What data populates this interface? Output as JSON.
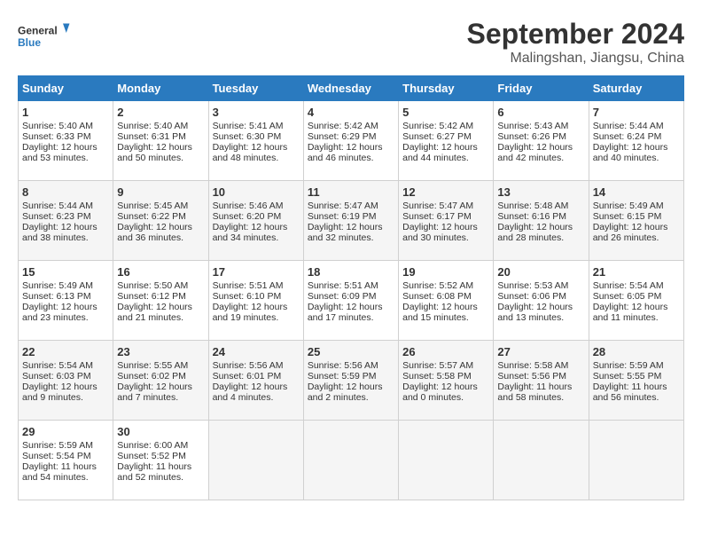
{
  "header": {
    "logo_line1": "General",
    "logo_line2": "Blue",
    "month": "September 2024",
    "location": "Malingshan, Jiangsu, China"
  },
  "weekdays": [
    "Sunday",
    "Monday",
    "Tuesday",
    "Wednesday",
    "Thursday",
    "Friday",
    "Saturday"
  ],
  "weeks": [
    [
      {
        "day": 1,
        "rise": "5:40 AM",
        "set": "6:33 PM",
        "hours": "12",
        "mins": "53"
      },
      {
        "day": 2,
        "rise": "5:40 AM",
        "set": "6:31 PM",
        "hours": "12",
        "mins": "50"
      },
      {
        "day": 3,
        "rise": "5:41 AM",
        "set": "6:30 PM",
        "hours": "12",
        "mins": "48"
      },
      {
        "day": 4,
        "rise": "5:42 AM",
        "set": "6:29 PM",
        "hours": "12",
        "mins": "46"
      },
      {
        "day": 5,
        "rise": "5:42 AM",
        "set": "6:27 PM",
        "hours": "12",
        "mins": "44"
      },
      {
        "day": 6,
        "rise": "5:43 AM",
        "set": "6:26 PM",
        "hours": "12",
        "mins": "42"
      },
      {
        "day": 7,
        "rise": "5:44 AM",
        "set": "6:24 PM",
        "hours": "12",
        "mins": "40"
      }
    ],
    [
      {
        "day": 8,
        "rise": "5:44 AM",
        "set": "6:23 PM",
        "hours": "12",
        "mins": "38"
      },
      {
        "day": 9,
        "rise": "5:45 AM",
        "set": "6:22 PM",
        "hours": "12",
        "mins": "36"
      },
      {
        "day": 10,
        "rise": "5:46 AM",
        "set": "6:20 PM",
        "hours": "12",
        "mins": "34"
      },
      {
        "day": 11,
        "rise": "5:47 AM",
        "set": "6:19 PM",
        "hours": "12",
        "mins": "32"
      },
      {
        "day": 12,
        "rise": "5:47 AM",
        "set": "6:17 PM",
        "hours": "12",
        "mins": "30"
      },
      {
        "day": 13,
        "rise": "5:48 AM",
        "set": "6:16 PM",
        "hours": "12",
        "mins": "28"
      },
      {
        "day": 14,
        "rise": "5:49 AM",
        "set": "6:15 PM",
        "hours": "12",
        "mins": "26"
      }
    ],
    [
      {
        "day": 15,
        "rise": "5:49 AM",
        "set": "6:13 PM",
        "hours": "12",
        "mins": "23"
      },
      {
        "day": 16,
        "rise": "5:50 AM",
        "set": "6:12 PM",
        "hours": "12",
        "mins": "21"
      },
      {
        "day": 17,
        "rise": "5:51 AM",
        "set": "6:10 PM",
        "hours": "12",
        "mins": "19"
      },
      {
        "day": 18,
        "rise": "5:51 AM",
        "set": "6:09 PM",
        "hours": "12",
        "mins": "17"
      },
      {
        "day": 19,
        "rise": "5:52 AM",
        "set": "6:08 PM",
        "hours": "12",
        "mins": "15"
      },
      {
        "day": 20,
        "rise": "5:53 AM",
        "set": "6:06 PM",
        "hours": "12",
        "mins": "13"
      },
      {
        "day": 21,
        "rise": "5:54 AM",
        "set": "6:05 PM",
        "hours": "12",
        "mins": "11"
      }
    ],
    [
      {
        "day": 22,
        "rise": "5:54 AM",
        "set": "6:03 PM",
        "hours": "12",
        "mins": "9"
      },
      {
        "day": 23,
        "rise": "5:55 AM",
        "set": "6:02 PM",
        "hours": "12",
        "mins": "7"
      },
      {
        "day": 24,
        "rise": "5:56 AM",
        "set": "6:01 PM",
        "hours": "12",
        "mins": "4"
      },
      {
        "day": 25,
        "rise": "5:56 AM",
        "set": "5:59 PM",
        "hours": "12",
        "mins": "2"
      },
      {
        "day": 26,
        "rise": "5:57 AM",
        "set": "5:58 PM",
        "hours": "12",
        "mins": "0"
      },
      {
        "day": 27,
        "rise": "5:58 AM",
        "set": "5:56 PM",
        "hours": "11",
        "mins": "58"
      },
      {
        "day": 28,
        "rise": "5:59 AM",
        "set": "5:55 PM",
        "hours": "11",
        "mins": "56"
      }
    ],
    [
      {
        "day": 29,
        "rise": "5:59 AM",
        "set": "5:54 PM",
        "hours": "11",
        "mins": "54"
      },
      {
        "day": 30,
        "rise": "6:00 AM",
        "set": "5:52 PM",
        "hours": "11",
        "mins": "52"
      },
      null,
      null,
      null,
      null,
      null
    ]
  ]
}
